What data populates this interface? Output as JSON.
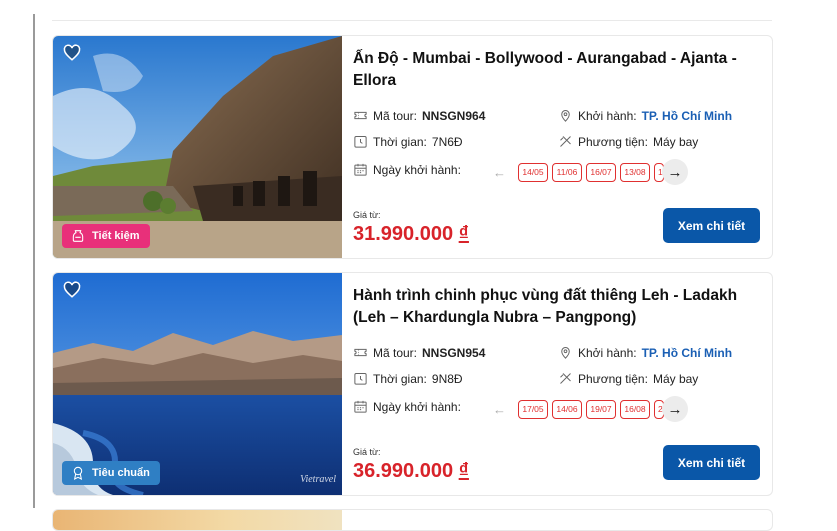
{
  "tours": [
    {
      "title": "Ấn Độ - Mumbai - Bollywood - Aurangabad - Ajanta - Ellora",
      "badge": "Tiết kiệm",
      "code_label": "Mã tour:",
      "code": "NNSGN964",
      "depart_label": "Khởi hành:",
      "depart_city": "TP. Hồ Chí Minh",
      "duration_label": "Thời gian:",
      "duration": "7N6Đ",
      "transport_label": "Phương tiện:",
      "transport": "Máy bay",
      "dates_label": "Ngày khởi hành:",
      "dates": [
        "14/05",
        "11/06",
        "16/07",
        "13/08"
      ],
      "dates_cut": "1",
      "price_label": "Giá từ:",
      "price": "31.990.000",
      "currency": "₫",
      "cta": "Xem chi tiết"
    },
    {
      "title": "Hành trình chinh phục vùng đất thiêng Leh - Ladakh (Leh – Khardungla Nubra – Pangpong)",
      "badge": "Tiêu chuẩn",
      "watermark": "Vietravel",
      "code_label": "Mã tour:",
      "code": "NNSGN954",
      "depart_label": "Khởi hành:",
      "depart_city": "TP. Hồ Chí Minh",
      "duration_label": "Thời gian:",
      "duration": "9N8Đ",
      "transport_label": "Phương tiện:",
      "transport": "Máy bay",
      "dates_label": "Ngày khởi hành:",
      "dates": [
        "17/05",
        "14/06",
        "19/07",
        "16/08"
      ],
      "dates_cut": "2",
      "price_label": "Giá từ:",
      "price": "36.990.000",
      "currency": "₫",
      "cta": "Xem chi tiết"
    }
  ],
  "icons": {
    "favorite": "heart-icon",
    "code": "ticket-icon",
    "depart": "location-pin-icon",
    "duration": "clock-icon",
    "transport": "transport-icon",
    "calendar": "calendar-icon",
    "prev": "arrow-left-icon",
    "next": "arrow-right-icon"
  },
  "colors": {
    "price": "#d8232a",
    "cta": "#0a57a8",
    "badge_saving": "#e8307a",
    "badge_standard": "#2f7fc4",
    "link": "#1a5fb4"
  }
}
